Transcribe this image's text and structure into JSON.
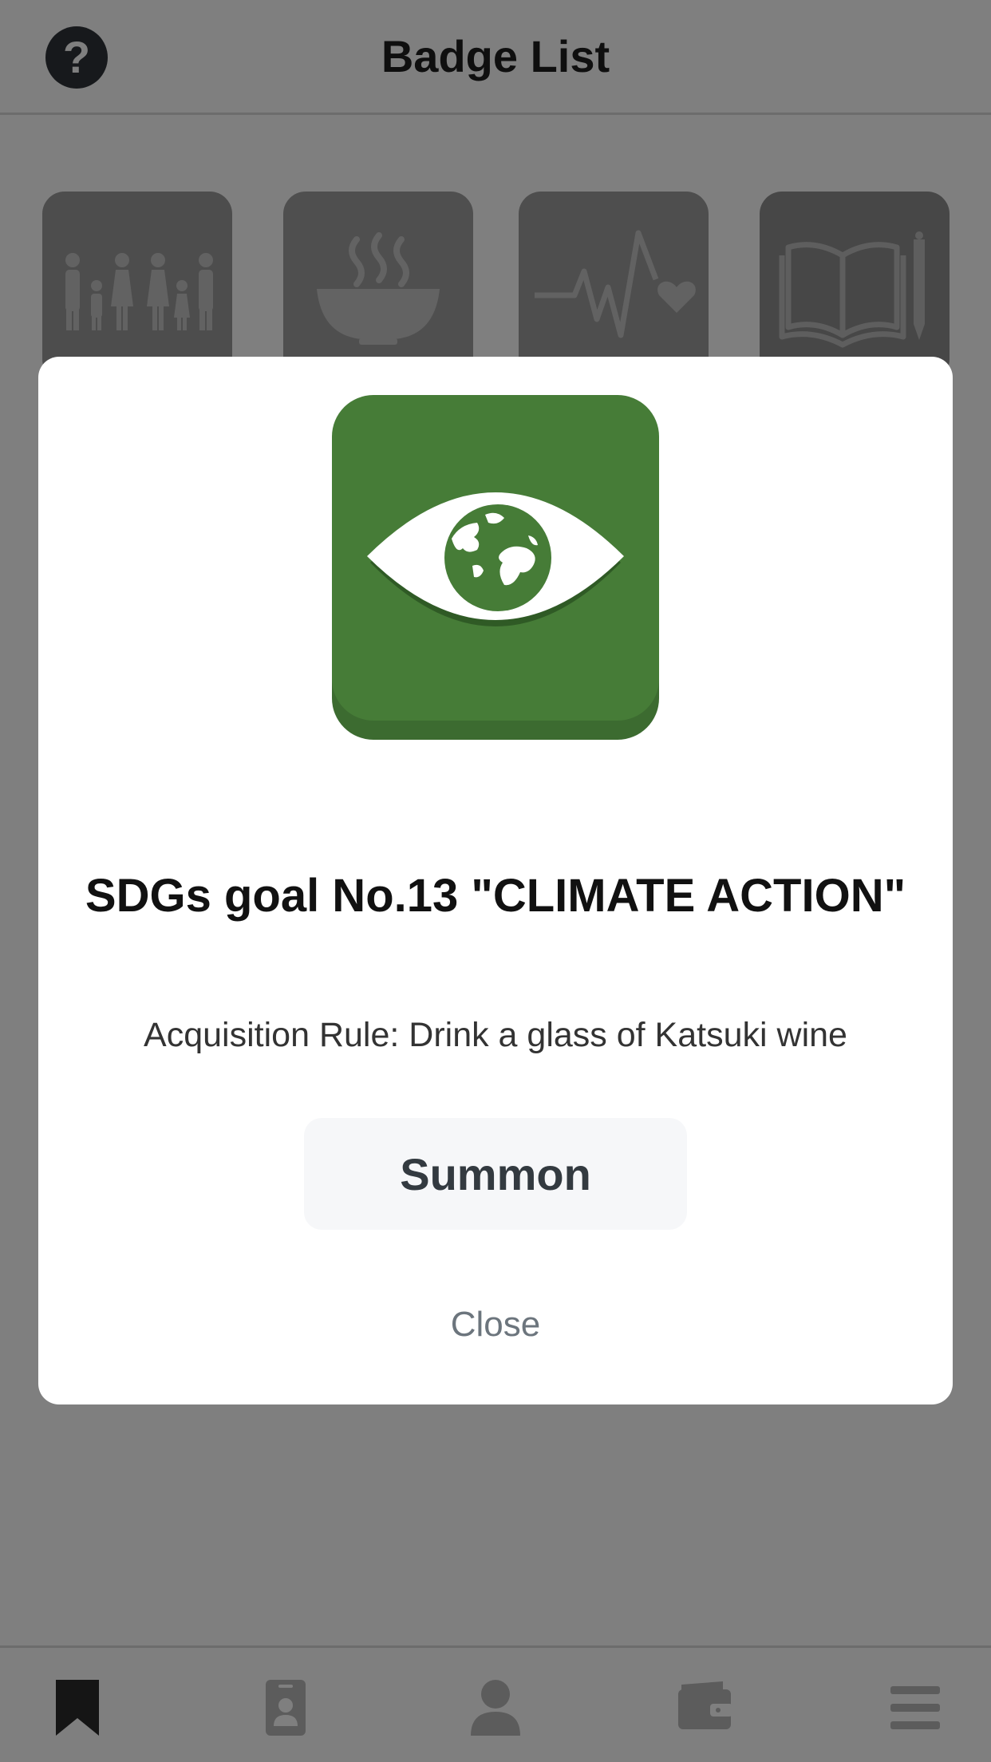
{
  "header": {
    "title": "Badge List",
    "help_icon": "question-circle-icon",
    "help_glyph": "?"
  },
  "badges": [
    {
      "name": "family-icon",
      "color": "#9a9a9a"
    },
    {
      "name": "food-bowl-icon",
      "color": "#9f9f9f"
    },
    {
      "name": "heartbeat-icon",
      "color": "#9c9c9c"
    },
    {
      "name": "book-pencil-icon",
      "color": "#8e8e8e"
    }
  ],
  "modal": {
    "badge_icon": "eye-globe-icon",
    "badge_color": "#467c37",
    "title": "SDGs goal No.13 \"CLIMATE ACTION\"",
    "rule": "Acquisition Rule: Drink a glass of Katsuki wine",
    "summon_label": "Summon",
    "close_label": "Close"
  },
  "tabbar": {
    "items": [
      {
        "icon": "bookmark-icon",
        "active": true
      },
      {
        "icon": "id-card-icon",
        "active": false
      },
      {
        "icon": "user-icon",
        "active": false
      },
      {
        "icon": "wallet-icon",
        "active": false
      },
      {
        "icon": "menu-icon",
        "active": false
      }
    ]
  },
  "colors": {
    "overlay": "rgba(0,0,0,0.5)",
    "active_tab": "#2b2b2b",
    "inactive_tab": "#b9b9b9",
    "summon_bg": "#f6f7f9"
  }
}
